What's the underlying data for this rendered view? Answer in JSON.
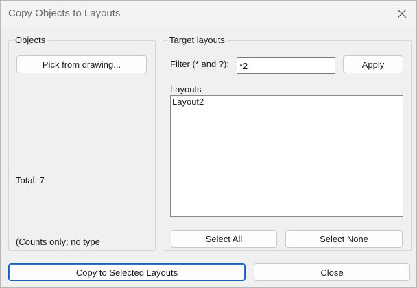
{
  "window": {
    "title": "Copy Objects to Layouts"
  },
  "objects_group": {
    "label": "Objects",
    "pick_button": "Pick from drawing...",
    "total": "Total: 7",
    "note": "(Counts only; no type"
  },
  "target_group": {
    "label": "Target layouts",
    "filter_label": "Filter (* and ?):",
    "filter_value": "*2",
    "apply_button": "Apply",
    "layouts_label": "Layouts",
    "layouts": [
      "Layout2"
    ],
    "select_all_button": "Select All",
    "select_none_button": "Select None"
  },
  "footer": {
    "copy_button": "Copy to Selected Layouts",
    "close_button": "Close"
  },
  "icons": {
    "close": "close-icon"
  },
  "colors": {
    "default_button_border": "#1a5fb4",
    "window_background": "#f0f0f0"
  }
}
